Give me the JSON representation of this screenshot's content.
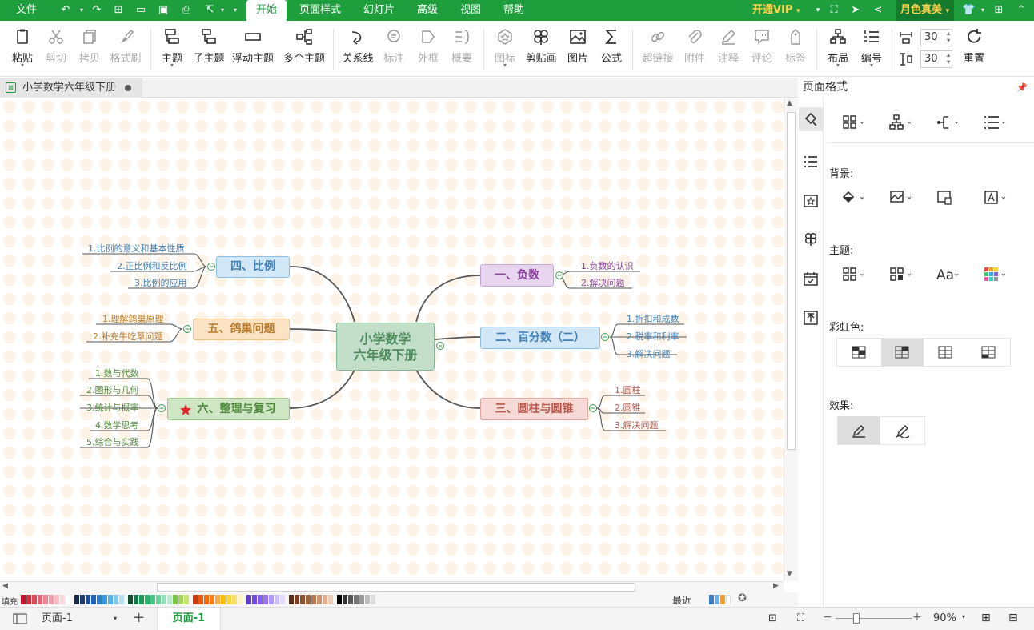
{
  "menubar": {
    "file": "文件",
    "tabs": [
      "开始",
      "页面样式",
      "幻灯片",
      "高级",
      "视图",
      "帮助"
    ],
    "vip": "开通VIP",
    "vip_caret": "▾",
    "user": "月色真美"
  },
  "ribbon": {
    "paste": "粘贴",
    "cut": "剪切",
    "copy": "拷贝",
    "format_painter": "格式刷",
    "topic": "主题",
    "subtopic": "子主题",
    "floating_topic": "浮动主题",
    "multi_topic": "多个主题",
    "relationship": "关系线",
    "callout": "标注",
    "boundary": "外框",
    "summary": "概要",
    "icon": "图标",
    "clipart": "剪贴画",
    "picture": "图片",
    "formula": "公式",
    "hyperlink": "超链接",
    "attachment": "附件",
    "comment": "注释",
    "review": "评论",
    "tag": "标签",
    "layout": "布局",
    "numbering": "编号",
    "spacing_h": "30",
    "spacing_v": "30",
    "reset": "重置"
  },
  "document_tab": {
    "title": "小学数学六年级下册"
  },
  "mindmap": {
    "central": {
      "line1": "小学数学",
      "line2": "六年级下册"
    },
    "branches": [
      {
        "label": "一、负数",
        "children": [
          "1.负数的认识",
          "2.解决问题"
        ]
      },
      {
        "label": "二、百分数（二）",
        "children": [
          "1.折扣和成数",
          "2.税率和利率",
          "3.解决问题"
        ]
      },
      {
        "label": "三、圆柱与圆锥",
        "children": [
          "1.圆柱",
          "2.圆锥",
          "3.解决问题"
        ]
      },
      {
        "label": "四、比例",
        "children": [
          "1.比例的意义和基本性质",
          "2.正比例和反比例",
          "3.比例的应用"
        ]
      },
      {
        "label": "五、鸽巢问题",
        "children": [
          "1.理解鸽巢原理",
          "2.补充牛吃草问题"
        ]
      },
      {
        "label": "六、整理与复习",
        "children": [
          "1.数与代数",
          "2.图形与几何",
          "3.统计与概率",
          "4.数学思考",
          "5.综合与实践"
        ]
      }
    ]
  },
  "palette": {
    "fill_label": "填充",
    "recent_label": "最近"
  },
  "statusbar": {
    "page_selector": "页面-1",
    "page_tab": "页面-1",
    "zoom": "90%"
  },
  "panel": {
    "title": "页面格式",
    "background_label": "背景:",
    "theme_label": "主题:",
    "rainbow_label": "彩虹色:",
    "effect_label": "效果:"
  },
  "colors": {
    "accent": "#1e9e3c",
    "vip": "#ffd24a",
    "branch1": "#e8d6f0",
    "branch2": "#d3e8f7",
    "branch3": "#f7d9d6",
    "branch4": "#d3e8f7",
    "branch5": "#fbe3c4",
    "branch6": "#cfe6c4",
    "central": "#c3dfc9"
  }
}
